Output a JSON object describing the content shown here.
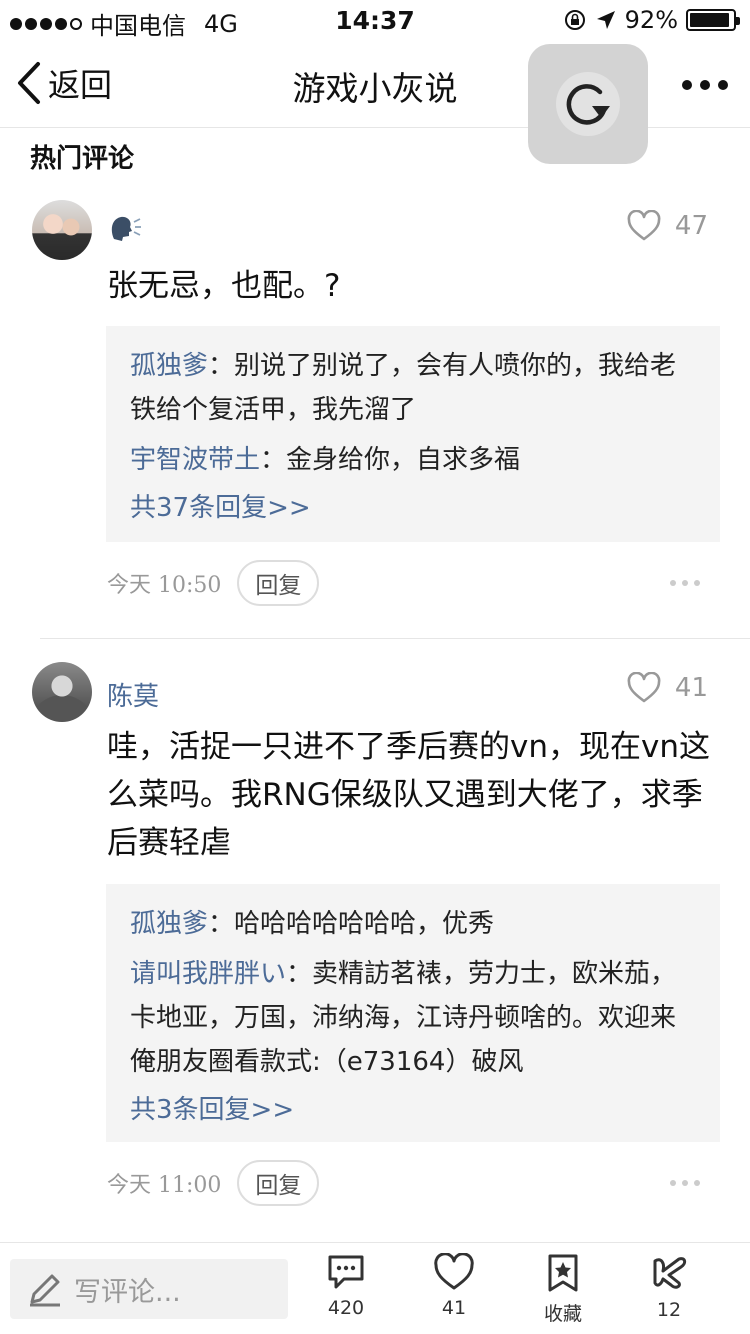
{
  "status": {
    "carrier": "中国电信",
    "network": "4G",
    "time": "14:37",
    "battery": "92%",
    "battery_level": 0.92
  },
  "nav": {
    "back_label": "返回",
    "title": "游戏小灰说"
  },
  "section_title": "热门评论",
  "comments": [
    {
      "username": "",
      "has_emoji_icon": true,
      "likes": "47",
      "text": "张无忌，也配。?",
      "replies": [
        {
          "name": "孤独爹",
          "text": "：别说了别说了，会有人喷你的，我给老铁给个复活甲，我先溜了"
        },
        {
          "name": "宇智波带土",
          "text": "：金身给你，自求多福"
        }
      ],
      "more_replies": "共37条回复>>",
      "time": "今天 10:50",
      "reply_label": "回复"
    },
    {
      "username": "陈莫",
      "likes": "41",
      "text": "哇，活捉一只进不了季后赛的vn，现在vn这么菜吗。我RNG保级队又遇到大佬了，求季后赛轻虐",
      "replies": [
        {
          "name": "孤独爹",
          "text": "：哈哈哈哈哈哈哈，优秀"
        },
        {
          "name": "请叫我胖胖い",
          "text": "：卖精訪茗裱，劳力士，欧米茄，卡地亚，万国，沛纳海，江诗丹顿啥的。欢迎来俺朋友圈看款式:（e73164）破风"
        }
      ],
      "more_replies": "共3条回复>>",
      "time": "今天 11:00",
      "reply_label": "回复"
    }
  ],
  "toolbar": {
    "write_placeholder": "写评论...",
    "comments_count": "420",
    "likes_count": "41",
    "favorite_label": "收藏",
    "share_count": "12"
  },
  "icons": {
    "back": "chevron-left-icon",
    "float": "refresh-icon",
    "more": "more-icon",
    "like": "heart-icon",
    "speaker": "speaking-head-icon",
    "pencil": "pencil-icon",
    "comment": "comment-bubble-icon",
    "favorite": "bookmark-star-icon",
    "share": "share-icon"
  }
}
